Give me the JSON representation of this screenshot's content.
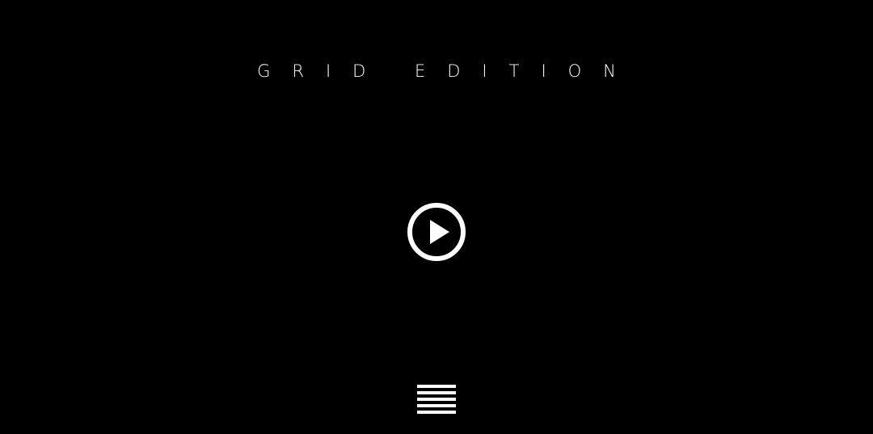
{
  "header": {
    "title": "GRID EDITION"
  },
  "controls": {
    "play_icon": "play-circle-icon",
    "menu_icon": "menu-lines-icon"
  },
  "colors": {
    "background": "#000000",
    "foreground": "#ffffff"
  }
}
